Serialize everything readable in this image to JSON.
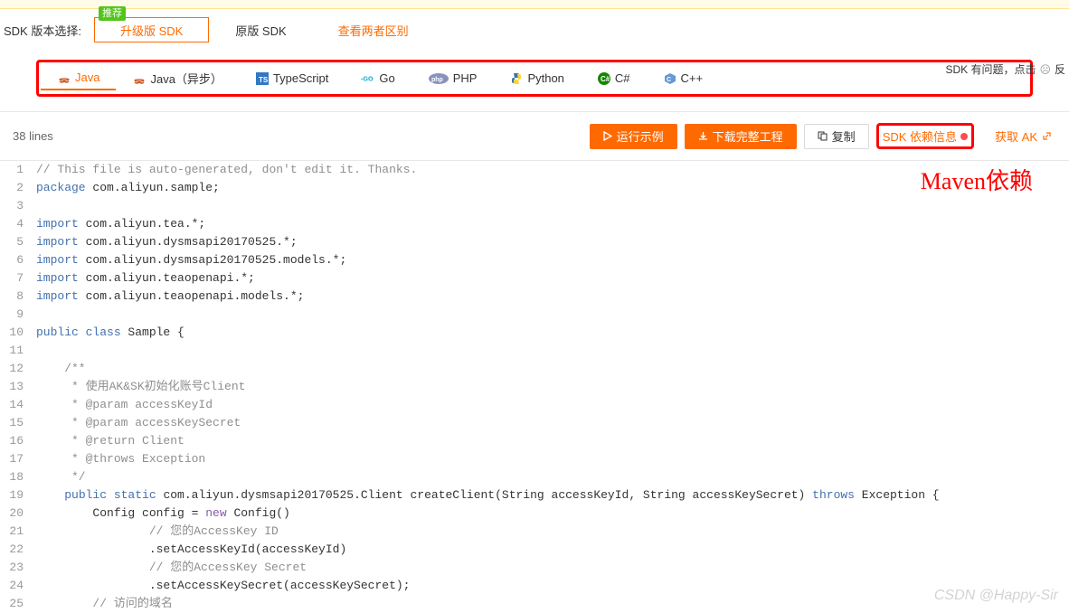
{
  "version": {
    "label": "SDK 版本选择:",
    "badge": "推荐",
    "tab_upgrade": "升级版 SDK",
    "tab_original": "原版 SDK",
    "compare": "查看两者区别"
  },
  "help": {
    "prefix": "SDK 有问题，点击",
    "suffix": "反"
  },
  "lang_tabs": {
    "java": "Java",
    "java_async": "Java（异步）",
    "typescript": "TypeScript",
    "go": "Go",
    "php": "PHP",
    "python": "Python",
    "csharp": "C#",
    "cpp": "C++"
  },
  "toolbar": {
    "lines": "38 lines",
    "run": "运行示例",
    "download": "下载完整工程",
    "copy": "复制",
    "sdk_dep": "SDK 依赖信息",
    "get_ak": "获取 AK"
  },
  "annotation": "Maven依赖",
  "code": [
    {
      "n": 1,
      "seg": [
        {
          "t": "// This file is auto-generated, don't edit it. Thanks.",
          "c": "c-comment"
        }
      ]
    },
    {
      "n": 2,
      "seg": [
        {
          "t": "package",
          "c": "c-keyword"
        },
        {
          "t": " com.aliyun.sample;"
        }
      ]
    },
    {
      "n": 3,
      "seg": []
    },
    {
      "n": 4,
      "seg": [
        {
          "t": "import",
          "c": "c-keyword"
        },
        {
          "t": " com.aliyun.tea.*;"
        }
      ]
    },
    {
      "n": 5,
      "seg": [
        {
          "t": "import",
          "c": "c-keyword"
        },
        {
          "t": " com.aliyun.dysmsapi20170525.*;"
        }
      ]
    },
    {
      "n": 6,
      "seg": [
        {
          "t": "import",
          "c": "c-keyword"
        },
        {
          "t": " com.aliyun.dysmsapi20170525.models.*;"
        }
      ]
    },
    {
      "n": 7,
      "seg": [
        {
          "t": "import",
          "c": "c-keyword"
        },
        {
          "t": " com.aliyun.teaopenapi.*;"
        }
      ]
    },
    {
      "n": 8,
      "seg": [
        {
          "t": "import",
          "c": "c-keyword"
        },
        {
          "t": " com.aliyun.teaopenapi.models.*;"
        }
      ]
    },
    {
      "n": 9,
      "seg": []
    },
    {
      "n": 10,
      "seg": [
        {
          "t": "public class",
          "c": "c-keyword"
        },
        {
          "t": " Sample {"
        }
      ]
    },
    {
      "n": 11,
      "seg": []
    },
    {
      "n": 12,
      "seg": [
        {
          "t": "    /**",
          "c": "c-comment"
        }
      ]
    },
    {
      "n": 13,
      "seg": [
        {
          "t": "     * 使用AK&SK初始化账号Client",
          "c": "c-comment"
        }
      ]
    },
    {
      "n": 14,
      "seg": [
        {
          "t": "     * @param accessKeyId",
          "c": "c-comment"
        }
      ]
    },
    {
      "n": 15,
      "seg": [
        {
          "t": "     * @param accessKeySecret",
          "c": "c-comment"
        }
      ]
    },
    {
      "n": 16,
      "seg": [
        {
          "t": "     * @return Client",
          "c": "c-comment"
        }
      ]
    },
    {
      "n": 17,
      "seg": [
        {
          "t": "     * @throws Exception",
          "c": "c-comment"
        }
      ]
    },
    {
      "n": 18,
      "seg": [
        {
          "t": "     */",
          "c": "c-comment"
        }
      ]
    },
    {
      "n": 19,
      "seg": [
        {
          "t": "    "
        },
        {
          "t": "public static",
          "c": "c-keyword"
        },
        {
          "t": " com.aliyun.dysmsapi20170525.Client createClient(String accessKeyId, String accessKeySecret) "
        },
        {
          "t": "throws",
          "c": "c-keyword"
        },
        {
          "t": " Exception {"
        }
      ]
    },
    {
      "n": 20,
      "seg": [
        {
          "t": "        Config config = "
        },
        {
          "t": "new",
          "c": "c-keyword2"
        },
        {
          "t": " Config()"
        }
      ]
    },
    {
      "n": 21,
      "seg": [
        {
          "t": "                "
        },
        {
          "t": "// 您的AccessKey ID",
          "c": "c-comment"
        }
      ]
    },
    {
      "n": 22,
      "seg": [
        {
          "t": "                .setAccessKeyId(accessKeyId)"
        }
      ]
    },
    {
      "n": 23,
      "seg": [
        {
          "t": "                "
        },
        {
          "t": "// 您的AccessKey Secret",
          "c": "c-comment"
        }
      ]
    },
    {
      "n": 24,
      "seg": [
        {
          "t": "                .setAccessKeySecret(accessKeySecret);"
        }
      ]
    },
    {
      "n": 25,
      "seg": [
        {
          "t": "        "
        },
        {
          "t": "// 访问的域名",
          "c": "c-comment"
        }
      ]
    }
  ],
  "watermark": "CSDN @Happy-Sir"
}
